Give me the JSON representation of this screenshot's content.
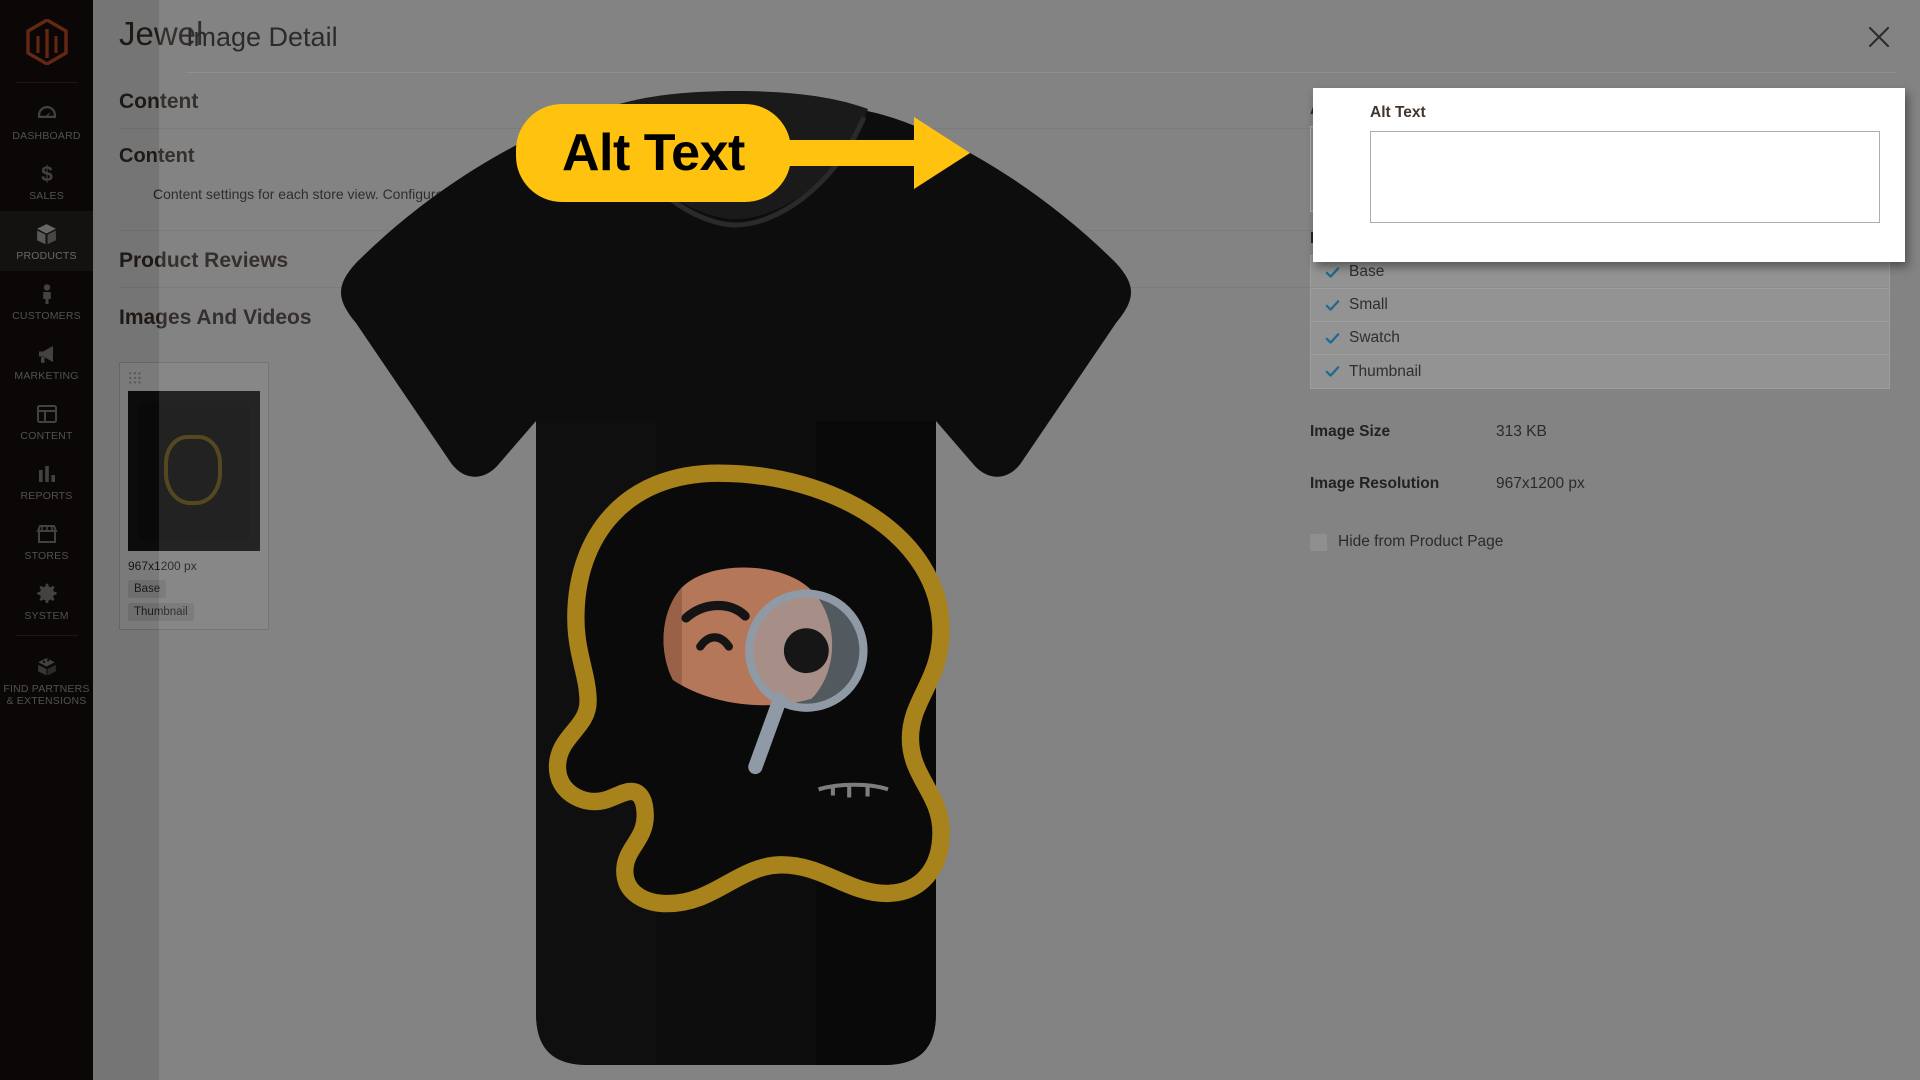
{
  "app": {
    "logo_icon": "magento-logo-icon"
  },
  "sidebar": {
    "items": [
      {
        "label": "Dashboard",
        "icon": "dashboard-icon",
        "active": false
      },
      {
        "label": "Sales",
        "icon": "dollar-icon",
        "active": false
      },
      {
        "label": "Products",
        "icon": "box-icon",
        "active": true
      },
      {
        "label": "Customers",
        "icon": "person-icon",
        "active": false
      },
      {
        "label": "Marketing",
        "icon": "megaphone-icon",
        "active": false
      },
      {
        "label": "Content",
        "icon": "layout-icon",
        "active": false
      },
      {
        "label": "Reports",
        "icon": "bar-chart-icon",
        "active": false
      },
      {
        "label": "Stores",
        "icon": "storefront-icon",
        "active": false
      },
      {
        "label": "System",
        "icon": "gear-icon",
        "active": false
      },
      {
        "label": "Find Partners & Extensions",
        "icon": "puzzle-block-icon",
        "active": false
      }
    ]
  },
  "background_page": {
    "title": "Jewel",
    "section_title": "Content",
    "section_subtitle": "Content",
    "section_paragraph": "Content settings for each store view. Configure each option below.",
    "product_section": "Product Reviews",
    "images_section": "Images And Videos",
    "thumbnail": {
      "resolution": "967x1200 px",
      "badges": [
        "Base",
        "Thumbnail"
      ],
      "grip_icon": "drag-grip-icon"
    }
  },
  "modal": {
    "title": "Image Detail",
    "close_icon": "close-icon",
    "preview_image_alt": "black t-shirt with mascot graphic"
  },
  "alt_text_panel": {
    "label": "Alt Text",
    "value": "",
    "placeholder": ""
  },
  "details": {
    "role_label": "Role",
    "roles": [
      {
        "label": "Base",
        "checked": true,
        "check_icon": "check-icon"
      },
      {
        "label": "Small",
        "checked": true,
        "check_icon": "check-icon"
      },
      {
        "label": "Swatch",
        "checked": true,
        "check_icon": "check-icon"
      },
      {
        "label": "Thumbnail",
        "checked": true,
        "check_icon": "check-icon"
      }
    ],
    "meta": [
      {
        "key": "Image Size",
        "value": "313 KB"
      },
      {
        "key": "Image Resolution",
        "value": "967x1200 px"
      }
    ],
    "hide_checkbox": {
      "label": "Hide from Product Page",
      "checked": false
    }
  },
  "callout": {
    "text": "Alt Text",
    "color": "#FFC20E",
    "arrow_icon": "right-arrow-icon"
  },
  "colors": {
    "accent_yellow": "#FFC20E",
    "sidebar_bg": "#16100e",
    "check_blue": "#1e6a8e",
    "overlay": "rgba(0,0,0,0.52)"
  }
}
